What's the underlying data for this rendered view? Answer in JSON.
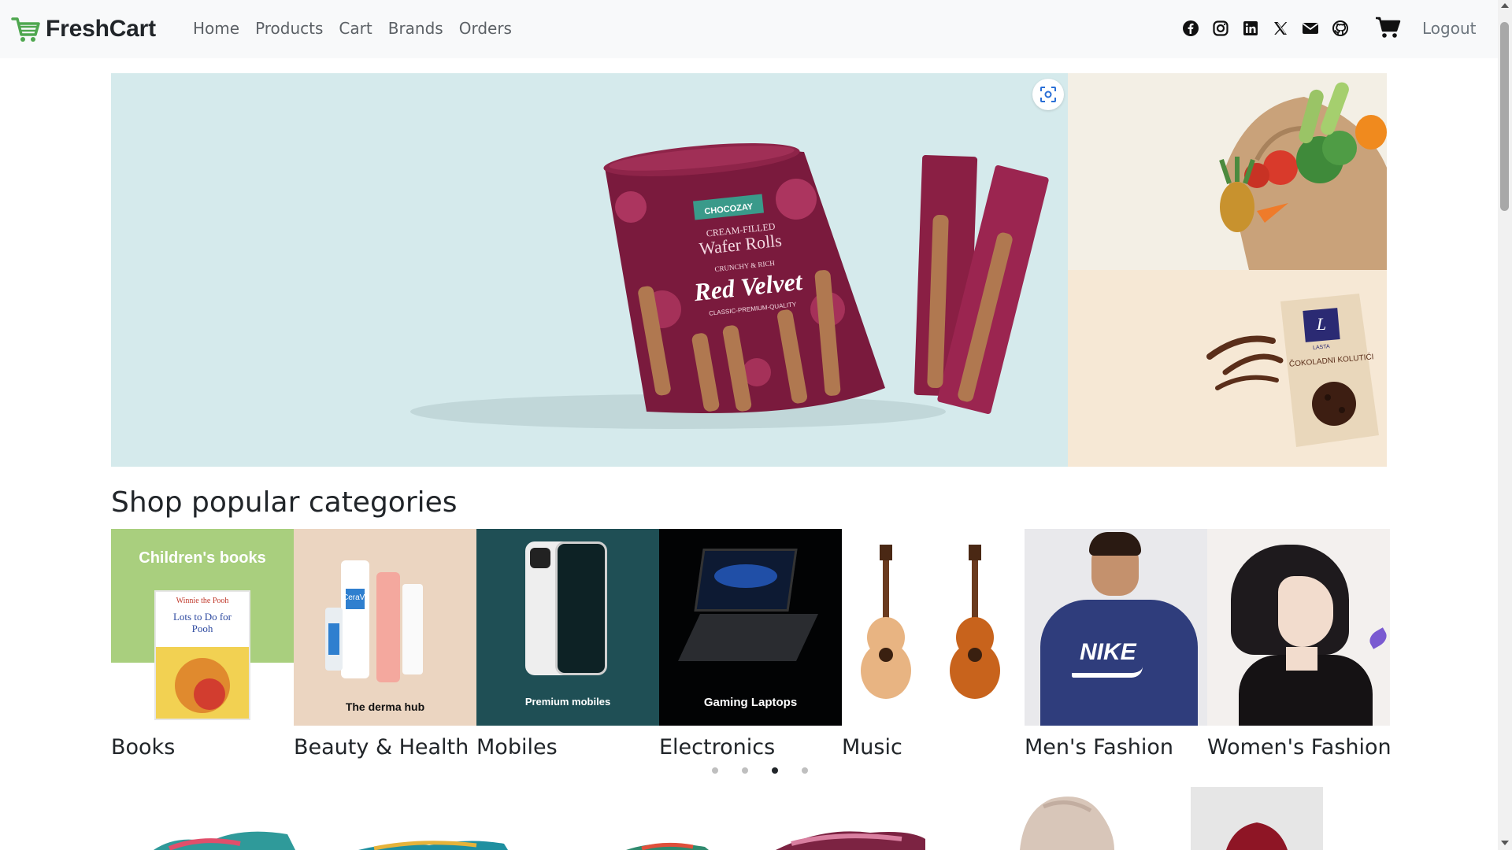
{
  "brand": {
    "name": "FreshCart",
    "icon": "shopping-cart-icon",
    "color": "#4fa74f"
  },
  "nav": {
    "links": [
      "Home",
      "Products",
      "Cart",
      "Brands",
      "Orders"
    ],
    "social_icons": [
      "facebook-icon",
      "instagram-icon",
      "linkedin-icon",
      "x-icon",
      "envelope-icon",
      "github-icon"
    ],
    "cart_icon": "cart-icon",
    "logout": "Logout"
  },
  "hero": {
    "main_slide": {
      "brand_badge": "CHOCOZAY",
      "line1": "CREAM-FILLED",
      "line2": "Wafer Rolls",
      "line3": "CRUNCHY & RICH",
      "line4": "Red Velvet",
      "line5": "CLASSIC-PREMIUM-QUALITY"
    },
    "side_bottom": {
      "brand": "LASTA",
      "product": "ČOKOLADNI KOLUTIĆI"
    },
    "lens_icon": "visual-search-icon"
  },
  "categories": {
    "title": "Shop popular categories",
    "items": [
      {
        "label": "Books",
        "caption": "Children's books",
        "book_title": "Winnie the Pooh",
        "book_sub": "Lots to Do for Pooh"
      },
      {
        "label": "Beauty & Health",
        "caption": "The derma hub",
        "product": "CeraVe"
      },
      {
        "label": "Mobiles",
        "caption": "Premium mobiles"
      },
      {
        "label": "Electronics",
        "caption": "Gaming Laptops"
      },
      {
        "label": "Music"
      },
      {
        "label": "Men's Fashion",
        "logo_text": "NIKE"
      },
      {
        "label": "Women's Fashion"
      }
    ],
    "carousel": {
      "pages": 4,
      "active": 3
    }
  }
}
